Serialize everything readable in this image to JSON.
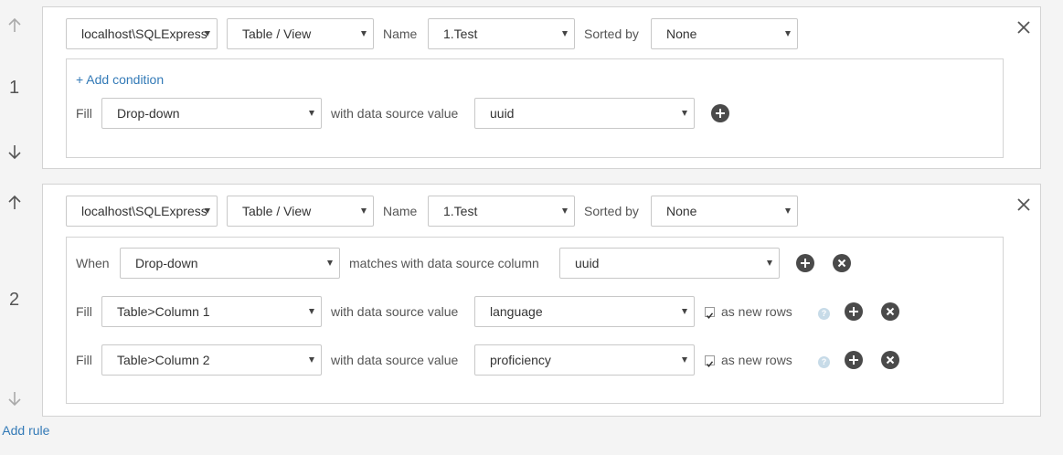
{
  "rules": [
    {
      "number": "1",
      "connection": "localhost\\SQLExpress",
      "source_type": "Table / View",
      "name_label": "Name",
      "name_value": "1.Test",
      "sorted_label": "Sorted by",
      "sorted_value": "None",
      "add_condition": "+ Add condition",
      "fill_label": "Fill",
      "fill_field": "Drop-down",
      "with_label": "with data source value",
      "with_value": "uuid"
    },
    {
      "number": "2",
      "connection": "localhost\\SQLExpress",
      "source_type": "Table / View",
      "name_label": "Name",
      "name_value": "1.Test",
      "sorted_label": "Sorted by",
      "sorted_value": "None",
      "when_label": "When",
      "when_field": "Drop-down",
      "matches_label": "matches with data source column",
      "matches_value": "uuid",
      "fills": [
        {
          "label": "Fill",
          "field": "Table>Column 1",
          "with_label": "with data source value",
          "value": "language",
          "checkbox_label": "as new rows",
          "checked": true
        },
        {
          "label": "Fill",
          "field": "Table>Column 2",
          "with_label": "with data source value",
          "value": "proficiency",
          "checkbox_label": "as new rows",
          "checked": true
        }
      ]
    }
  ],
  "add_rule": "+ Add rule",
  "colors": {
    "link": "#337ab7",
    "icon_dark": "#4a4a4a",
    "border": "#d3d3d3",
    "background": "#f4f4f4"
  },
  "icons": {
    "up": "arrow-up-icon",
    "down": "arrow-down-icon",
    "close": "close-icon",
    "add": "plus-circle-icon",
    "remove": "x-circle-icon",
    "help": "question-icon"
  }
}
